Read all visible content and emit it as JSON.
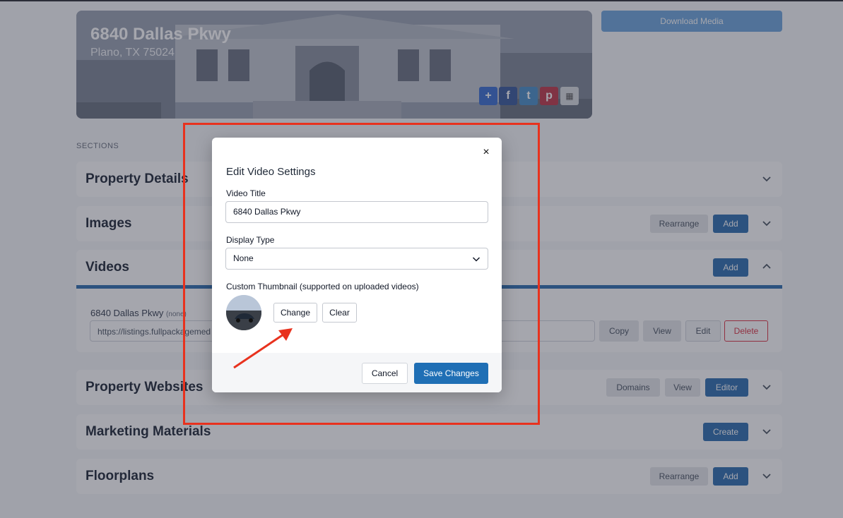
{
  "hero": {
    "address": "6840 Dallas Pkwy",
    "city": "Plano, TX 75024",
    "share_icons": [
      "plus-icon",
      "facebook-icon",
      "twitter-icon",
      "pinterest-icon",
      "qr-code-icon"
    ]
  },
  "download_label": "Download Media",
  "sections_label": "SECTIONS",
  "sections": {
    "property_details": {
      "title": "Property Details"
    },
    "images": {
      "title": "Images",
      "rearrange": "Rearrange",
      "add": "Add"
    },
    "videos": {
      "title": "Videos",
      "add": "Add",
      "item": {
        "title": "6840 Dallas Pkwy",
        "tag": "(none)",
        "url": "https://listings.fullpackagemed",
        "copy": "Copy",
        "view": "View",
        "edit": "Edit",
        "delete": "Delete"
      }
    },
    "property_websites": {
      "title": "Property Websites",
      "domains": "Domains",
      "view": "View",
      "editor": "Editor"
    },
    "marketing_materials": {
      "title": "Marketing Materials",
      "create": "Create"
    },
    "floorplans": {
      "title": "Floorplans",
      "rearrange": "Rearrange",
      "add": "Add"
    }
  },
  "modal": {
    "title": "Edit Video Settings",
    "close": "×",
    "video_title_label": "Video Title",
    "video_title_value": "6840 Dallas Pkwy",
    "display_type_label": "Display Type",
    "display_type_value": "None",
    "thumbnail_label": "Custom Thumbnail (supported on uploaded videos)",
    "change": "Change",
    "clear": "Clear",
    "cancel": "Cancel",
    "save": "Save Changes"
  },
  "colors": {
    "accent": "#1f6fb5",
    "annotation": "#e8321e",
    "danger": "#dc3545"
  }
}
